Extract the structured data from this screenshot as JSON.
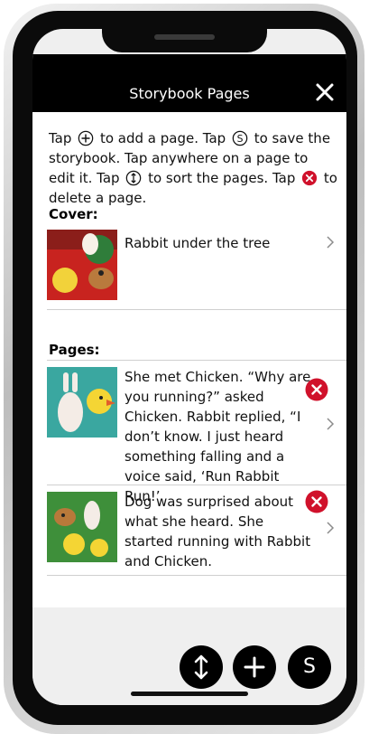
{
  "header": {
    "title": "Storybook Pages"
  },
  "instructions": {
    "p1": "Tap",
    "p2": "to add a page. Tap",
    "p3": "to save the storybook. Tap anywhere on a page to edit it. Tap",
    "p4": "to sort the pages. Tap",
    "p5": "to delete a page."
  },
  "cover": {
    "heading": "Cover:",
    "text": "Rabbit under the tree"
  },
  "pages": {
    "heading": "Pages:",
    "items": [
      {
        "text": "She met Chicken. “Why are you running?” asked Chicken. Rabbit replied, “I don’t know. I just heard something falling and a voice said, ‘Run Rabbit Run!’"
      },
      {
        "text": "Dog was surprised about what she heard. She started running with Rabbit and Chicken."
      }
    ]
  },
  "fab": {
    "save_label": "S"
  },
  "colors": {
    "delete_red": "#d0112b",
    "titlebar": "#000000"
  }
}
